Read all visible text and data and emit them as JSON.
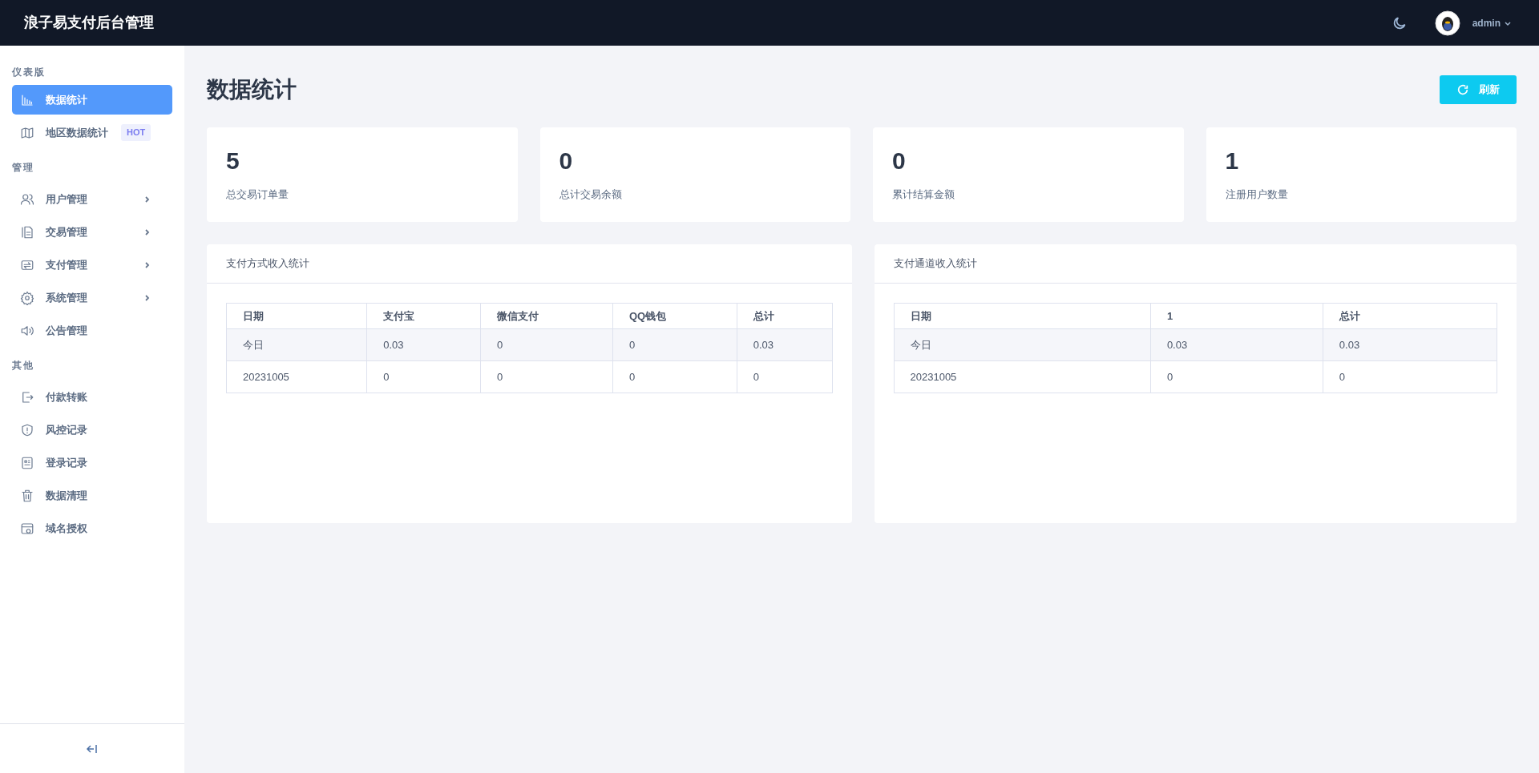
{
  "header": {
    "title": "浪子易支付后台管理",
    "user": "admin"
  },
  "sidebar": {
    "sections": [
      {
        "label": "仪表版",
        "items": [
          {
            "label": "数据统计",
            "kind": "chart",
            "selected": true,
            "expandable": false
          },
          {
            "label": "地区数据统计",
            "kind": "map",
            "selected": false,
            "expandable": false,
            "badge": "HOT"
          }
        ]
      },
      {
        "label": "管理",
        "items": [
          {
            "label": "用户管理",
            "kind": "users",
            "selected": false,
            "expandable": true
          },
          {
            "label": "交易管理",
            "kind": "file",
            "selected": false,
            "expandable": true
          },
          {
            "label": "支付管理",
            "kind": "transfer",
            "selected": false,
            "expandable": true
          },
          {
            "label": "系统管理",
            "kind": "gear",
            "selected": false,
            "expandable": true
          },
          {
            "label": "公告管理",
            "kind": "speaker",
            "selected": false,
            "expandable": false
          }
        ]
      },
      {
        "label": "其他",
        "items": [
          {
            "label": "付款转账",
            "kind": "exit",
            "selected": false,
            "expandable": false
          },
          {
            "label": "风控记录",
            "kind": "shield",
            "selected": false,
            "expandable": false
          },
          {
            "label": "登录记录",
            "kind": "list",
            "selected": false,
            "expandable": false
          },
          {
            "label": "数据清理",
            "kind": "trash",
            "selected": false,
            "expandable": false
          },
          {
            "label": "域名授权",
            "kind": "browser",
            "selected": false,
            "expandable": false
          }
        ]
      }
    ]
  },
  "page": {
    "title": "数据统计",
    "refresh_button": "刷新"
  },
  "stats": [
    {
      "value": "5",
      "label": "总交易订单量"
    },
    {
      "value": "0",
      "label": "总计交易余额"
    },
    {
      "value": "0",
      "label": "累计结算金额"
    },
    {
      "value": "1",
      "label": "注册用户数量"
    }
  ],
  "tables": [
    {
      "title": "支付方式收入统计",
      "columns": [
        "日期",
        "支付宝",
        "微信支付",
        "QQ钱包",
        "总计"
      ],
      "rows": [
        [
          "今日",
          "0.03",
          "0",
          "0",
          "0.03"
        ],
        [
          "20231005",
          "0",
          "0",
          "0",
          "0"
        ]
      ]
    },
    {
      "title": "支付通道收入统计",
      "columns": [
        "日期",
        "1",
        "总计"
      ],
      "rows": [
        [
          "今日",
          "0.03",
          "0.03"
        ],
        [
          "20231005",
          "0",
          "0"
        ]
      ]
    }
  ]
}
